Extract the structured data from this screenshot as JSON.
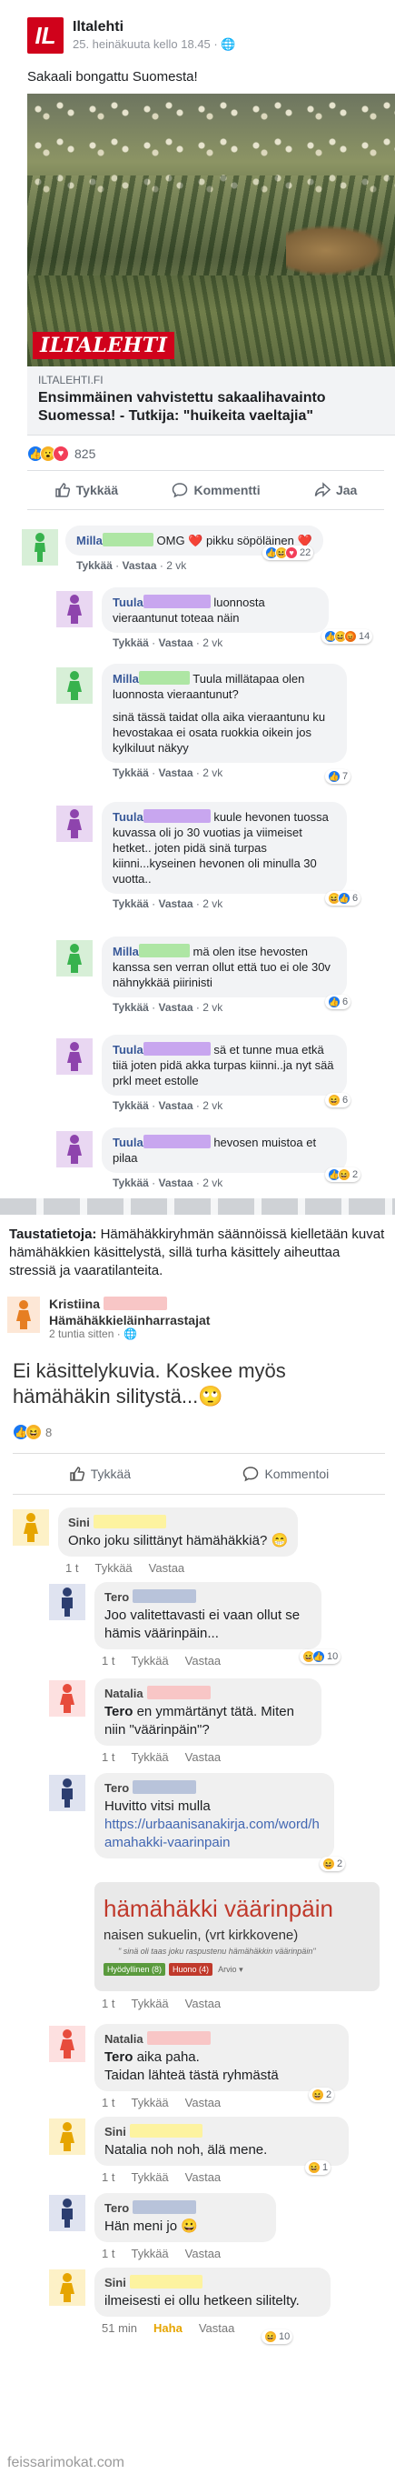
{
  "post": {
    "page_name": "Iltalehti",
    "logo_text": "IL",
    "time": "25. heinäkuuta kello 18.45 · 🌐",
    "text": "Sakaali bongattu Suomesta!",
    "watermark": "ILTALEHTI",
    "link_domain": "ILTALEHTI.FI",
    "link_title": "Ensimmäinen vahvistettu sakaalihavainto Suomessa! - Tutkija: \"huikeita vaeltajia\"",
    "reaction_count": "825",
    "actions": {
      "like": "Tykkää",
      "comment": "Kommentti",
      "share": "Jaa"
    }
  },
  "thread1": [
    {
      "name": "Milla",
      "text": "OMG ❤️ pikku söpöläinen ❤️",
      "like": "Tykkää",
      "reply": "Vastaa",
      "time": "2 vk",
      "reactions": "22"
    },
    {
      "name": "Tuula",
      "text": "luonnosta vieraantunut toteaa näin",
      "like": "Tykkää",
      "reply": "Vastaa",
      "time": "2 vk",
      "reactions": "14"
    },
    {
      "name": "Milla",
      "text1": "Tuula millätapaa olen luonnosta vieraantunut?",
      "text2": "sinä tässä taidat olla aika vieraantunu ku hevostakaa ei osata ruokkia oikein jos kylkiluut näkyy",
      "like": "Tykkää",
      "reply": "Vastaa",
      "time": "2 vk",
      "reactions": "7"
    },
    {
      "name": "Tuula",
      "text": "kuule hevonen tuossa kuvassa oli jo 30 vuotias ja viimeiset hetket.. joten pidä sinä turpas kiinni...kyseinen hevonen oli minulla 30 vuotta..",
      "like": "Tykkää",
      "reply": "Vastaa",
      "time": "2 vk",
      "reactions": "6"
    },
    {
      "name": "Milla",
      "text": "mä olen itse hevosten kanssa sen verran ollut että tuo ei ole 30v nähnykkää piirinisti",
      "like": "Tykkää",
      "reply": "Vastaa",
      "time": "2 vk",
      "reactions": "6"
    },
    {
      "name": "Tuula",
      "text": "sä et tunne mua etkä tiiä joten pidä akka turpas kiinni..ja nyt sää prkl meet estolle",
      "like": "Tykkää",
      "reply": "Vastaa",
      "time": "2 vk",
      "reactions": "6"
    },
    {
      "name": "Tuula",
      "text": "hevosen muistoa et pilaa",
      "like": "Tykkää",
      "reply": "Vastaa",
      "time": "2 vk",
      "reactions": "2"
    }
  ],
  "background": {
    "label": "Taustatietoja:",
    "text": " Hämähäkkiryhmän säännöissä kielletään kuvat hämähäkkien käsittelystä, sillä turha käsittely aiheuttaa stressiä ja vaaratilanteita."
  },
  "post2": {
    "author": "Kristiina",
    "group": "Hämähäkkieläinharrastajat",
    "time": "2 tuntia sitten · 🌐",
    "text": "Ei käsittelykuvia. Koskee myös hämähäkin silitystä...🙄",
    "reaction_count": "8",
    "actions": {
      "like": "Tykkää",
      "comment": "Kommentoi"
    }
  },
  "thread2": [
    {
      "name": "Sini",
      "text": "Onko joku silittänyt hämähäkkiä? 😁",
      "age": "1 t",
      "like": "Tykkää",
      "reply": "Vastaa"
    },
    {
      "name": "Tero",
      "text": "Joo valitettavasti ei vaan ollut se hämis väärinpäin...",
      "age": "1 t",
      "like": "Tykkää",
      "reply": "Vastaa",
      "reactions": "10"
    },
    {
      "name": "Natalia",
      "tag": "Tero",
      "text": " en ymmärtänyt tätä. Miten niin \"väärinpäin\"?",
      "age": "1 t",
      "like": "Tykkää",
      "reply": "Vastaa"
    },
    {
      "name": "Tero",
      "text": "Huvitto vitsi mulla",
      "link": "https://urbaanisanakirja.com/word/hamahakki-vaarinpain",
      "age": "1 t",
      "like": "Tykkää",
      "reply": "Vastaa",
      "reactions": "2"
    },
    {
      "name": "Natalia",
      "tag": "Tero",
      "text1": " aika paha.",
      "text2": "Taidan lähteä tästä ryhmästä",
      "age": "1 t",
      "like": "Tykkää",
      "reply": "Vastaa",
      "reactions": "2"
    },
    {
      "name": "Sini",
      "text": "Natalia noh noh, älä mene.",
      "age": "1 t",
      "like": "Tykkää",
      "reply": "Vastaa",
      "reactions": "1"
    },
    {
      "name": "Tero",
      "text": "Hän meni jo 😀",
      "age": "1 t",
      "like": "Tykkää",
      "reply": "Vastaa"
    },
    {
      "name": "Sini",
      "text": "ilmeisesti ei ollu hetkeen silitelty.",
      "age": "51 min",
      "haha": "Haha",
      "reply": "Vastaa",
      "reactions": "10"
    }
  ],
  "preview": {
    "title": "hämähäkki väärinpäin",
    "subtitle": "naisen sukuelin, (vrt kirkkovene)",
    "quote": "\" sinä oli taas joku raspustenu hämähäkkin väärinpäin\"",
    "tag1": "Hyödyllinen (8)",
    "tag2": "Huono (4)",
    "tag3": "Arvio ▾"
  },
  "footer": "feissarimokat.com"
}
